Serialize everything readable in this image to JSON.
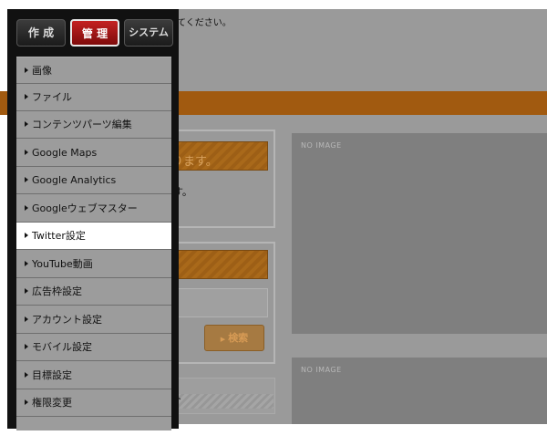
{
  "background": {
    "top_text": "てください。",
    "orange_bar_text": "ります。",
    "panel_text": "す。",
    "search_button_label": "検索",
    "lower_text": "ト",
    "image_placeholder_1": "NO IMAGE",
    "image_placeholder_2": "NO IMAGE"
  },
  "tabs": {
    "create": "作 成",
    "manage": "管 理",
    "system": "システム"
  },
  "menu": {
    "items": [
      {
        "label": "画像"
      },
      {
        "label": "ファイル"
      },
      {
        "label": "コンテンツパーツ編集"
      },
      {
        "label": "Google Maps"
      },
      {
        "label": "Google Analytics"
      },
      {
        "label": "Googleウェブマスター"
      },
      {
        "label": "Twitter設定"
      },
      {
        "label": "YouTube動画"
      },
      {
        "label": "広告枠設定"
      },
      {
        "label": "アカウント設定"
      },
      {
        "label": "モバイル設定"
      },
      {
        "label": "目標設定"
      },
      {
        "label": "権限変更"
      }
    ],
    "active_label": "Twitter設定"
  },
  "colors": {
    "accent_orange": "#a15a10",
    "active_tab_red": "#b01818",
    "menu_bg": "#9c9c9c",
    "menu_active_bg": "#ffffff"
  }
}
